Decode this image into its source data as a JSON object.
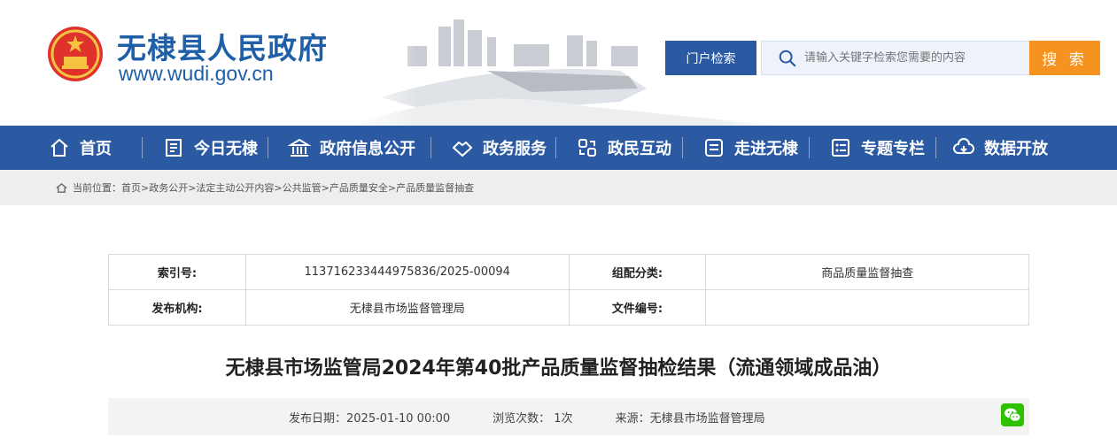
{
  "header": {
    "site_name": "无棣县人民政府",
    "site_url": "www.wudi.gov.cn",
    "portal_search_label": "门户检索",
    "search_placeholder": "请输入关键字检索您需要的内容",
    "search_button": "搜 索"
  },
  "nav": {
    "items": [
      {
        "label": "首页",
        "icon": "home-icon"
      },
      {
        "label": "今日无棣",
        "icon": "news-icon"
      },
      {
        "label": "政府信息公开",
        "icon": "government-building-icon"
      },
      {
        "label": "政务服务",
        "icon": "handshake-icon"
      },
      {
        "label": "政民互动",
        "icon": "interaction-icon"
      },
      {
        "label": "走进无棣",
        "icon": "document-list-icon"
      },
      {
        "label": "专题专栏",
        "icon": "list-icon"
      },
      {
        "label": "数据开放",
        "icon": "cloud-download-icon"
      }
    ]
  },
  "breadcrumb": "当前位置：首页>政务公开>法定主动公开内容>公共监管>产品质量安全>产品质量监督抽查",
  "meta": {
    "index_label": "索引号:",
    "index_value": "113716233444975836/2025-00094",
    "category_label": "组配分类:",
    "category_value": "商品质量监督抽查",
    "publisher_label": "发布机构:",
    "publisher_value": "无棣县市场监督管理局",
    "docno_label": "文件编号:",
    "docno_value": ""
  },
  "article": {
    "title": "无棣县市场监管局2024年第40批产品质量监督抽检结果（流通领域成品油）",
    "publish_date": "发布日期：2025-01-10 00:00",
    "views": "浏览次数： 1次",
    "source": "来源：无棣县市场监督管理局"
  },
  "colors": {
    "primary": "#2b5aa3",
    "accent": "#f59220",
    "title_blue": "#1e5fa8"
  }
}
